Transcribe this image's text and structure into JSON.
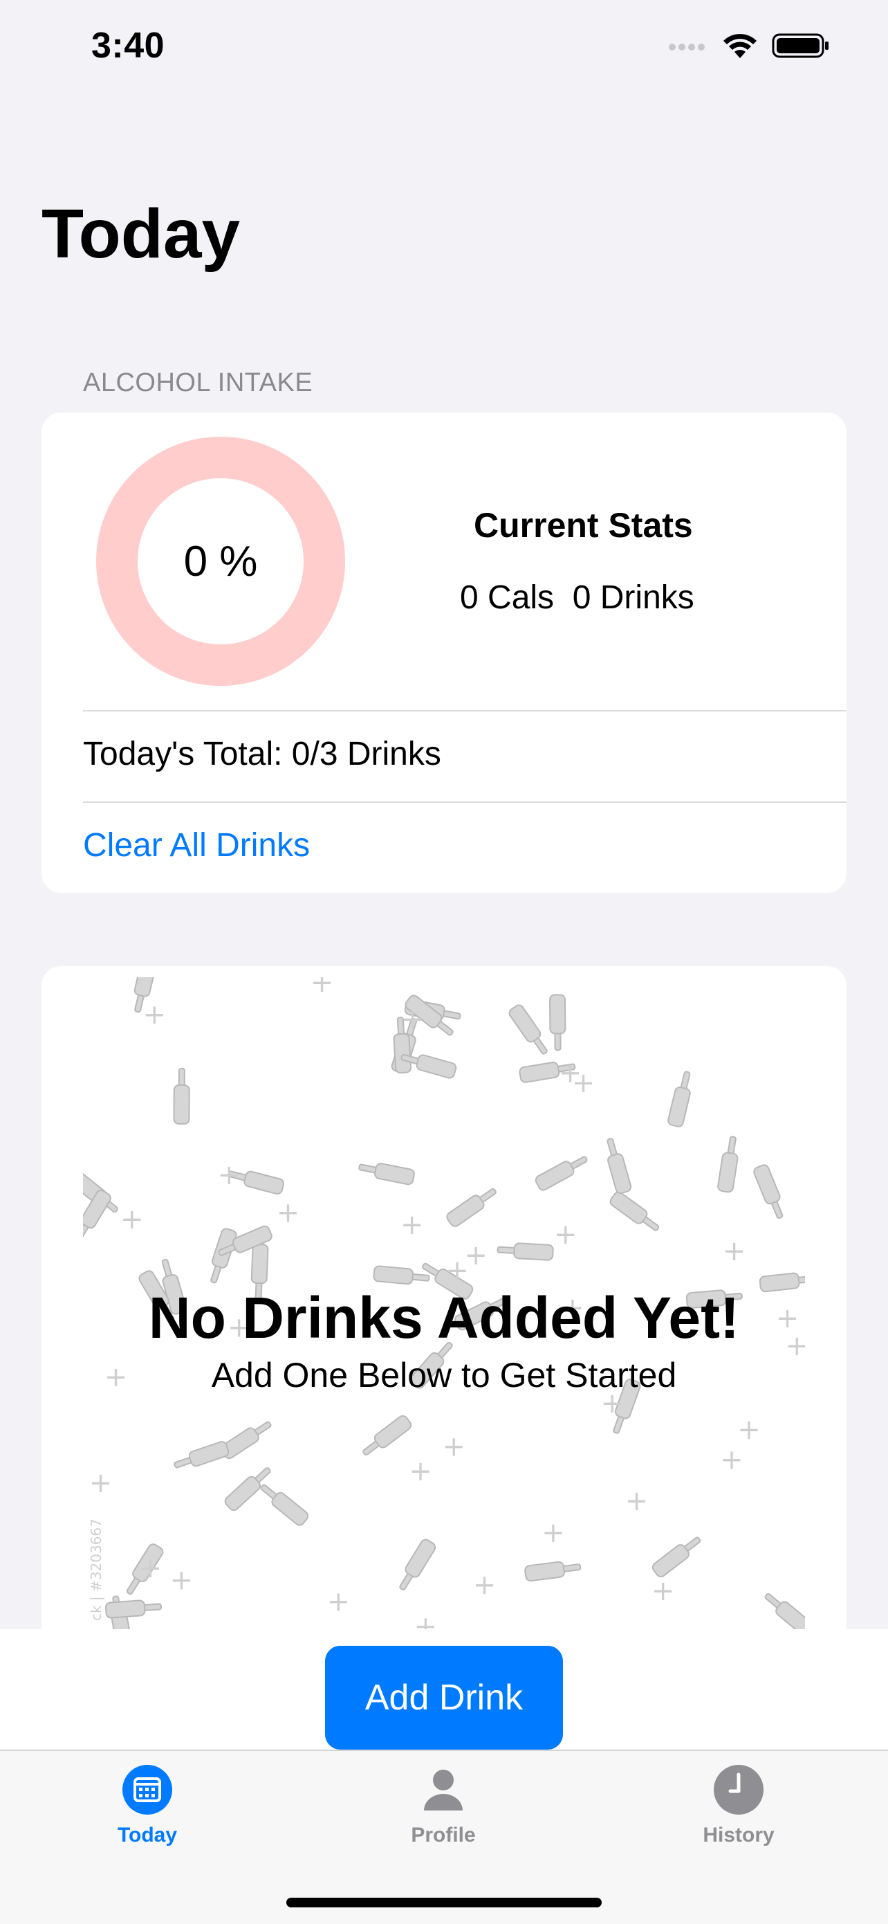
{
  "status_bar": {
    "time": "3:40"
  },
  "page": {
    "title": "Today"
  },
  "intake_section": {
    "header": "ALCOHOL INTAKE",
    "ring_percent_label": "0 %",
    "ring_progress_fraction": 0,
    "ring_color": "#ffcdcc",
    "stats_title": "Current Stats",
    "stats_values": "0 Cals  0 Drinks",
    "total_row": "Today's Total: 0/3 Drinks",
    "clear_label": "Clear All Drinks"
  },
  "empty_state": {
    "title": "No Drinks Added Yet!",
    "subtitle": "Add One Below to Get Started",
    "watermark": "ck | #3203667"
  },
  "actions": {
    "add_label": "Add Drink"
  },
  "tab_bar": {
    "tabs": [
      {
        "label": "Today",
        "icon": "calendar-icon",
        "active": true
      },
      {
        "label": "Profile",
        "icon": "person-icon",
        "active": false
      },
      {
        "label": "History",
        "icon": "clock-icon",
        "active": false
      }
    ]
  },
  "colors": {
    "accent": "#007aff",
    "background": "#f2f2f7",
    "muted": "#8e8e93"
  }
}
